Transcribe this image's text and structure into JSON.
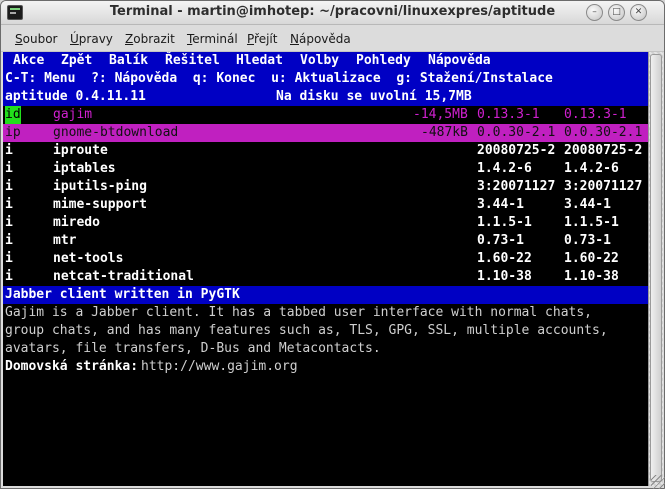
{
  "window": {
    "title": "Terminal - martin@imhotep: ~/pracovni/linuxexpres/aptitude",
    "btn_min": "–",
    "btn_max": "□",
    "btn_close": "✕"
  },
  "menubar": [
    {
      "pre": "",
      "u": "S",
      "post": "oubor"
    },
    {
      "pre": "",
      "u": "Ú",
      "post": "pravy"
    },
    {
      "pre": "",
      "u": "Z",
      "post": "obrazit"
    },
    {
      "pre": "",
      "u": "T",
      "post": "erminál"
    },
    {
      "pre": "",
      "u": "P",
      "post": "řejít"
    },
    {
      "pre": "",
      "u": "N",
      "post": "ápověda"
    }
  ],
  "aptitude": {
    "menu": [
      "Akce",
      "Zpět",
      "Balík",
      "Řešitel",
      "Hledat",
      "Volby",
      "Pohledy",
      "Nápověda"
    ],
    "help_line": "C-T: Menu  ?: Nápověda  q: Konec  u: Aktualizace  g: Stažení/Instalace",
    "status_left": "aptitude 0.4.11.11",
    "status_right": "Na disku se uvolní 15,7MB",
    "packages": [
      {
        "flag": "id",
        "name": "gajim",
        "size": "-14,5MB",
        "cur": "0.13.3-1",
        "cand": "0.13.3-1"
      },
      {
        "flag": "ip",
        "name": "gnome-btdownload",
        "size": "-487kB",
        "cur": "0.0.30-2.1",
        "cand": "0.0.30-2.1"
      },
      {
        "flag": "i",
        "name": "iproute",
        "size": "",
        "cur": "20080725-2",
        "cand": "20080725-2"
      },
      {
        "flag": "i",
        "name": "iptables",
        "size": "",
        "cur": "1.4.2-6",
        "cand": "1.4.2-6"
      },
      {
        "flag": "i",
        "name": "iputils-ping",
        "size": "",
        "cur": "3:20071127",
        "cand": "3:20071127"
      },
      {
        "flag": "i",
        "name": "mime-support",
        "size": "",
        "cur": "3.44-1",
        "cand": "3.44-1"
      },
      {
        "flag": "i",
        "name": "miredo",
        "size": "",
        "cur": "1.1.5-1",
        "cand": "1.1.5-1"
      },
      {
        "flag": "i",
        "name": "mtr",
        "size": "",
        "cur": "0.73-1",
        "cand": "0.73-1"
      },
      {
        "flag": "i",
        "name": "net-tools",
        "size": "",
        "cur": "1.60-22",
        "cand": "1.60-22"
      },
      {
        "flag": "i",
        "name": "netcat-traditional",
        "size": "",
        "cur": "1.10-38",
        "cand": "1.10-38"
      }
    ],
    "desc_title": "Jabber client written in PyGTK",
    "desc_lines": [
      "Gajim is a Jabber client. It has a tabbed user interface with normal chats,",
      "group chats, and has many features such as, TLS, GPG, SSL, multiple accounts,",
      "avatars, file transfers, D-Bus and Metacontacts."
    ],
    "homepage_label": "Domovská stránka:",
    "homepage_url": "http://www.gajim.org"
  },
  "colors": {
    "bar_blue": "#0000c4",
    "selected_magenta": "#c020c0",
    "flag_green": "#22e01c",
    "purple_text": "#d020d0"
  }
}
